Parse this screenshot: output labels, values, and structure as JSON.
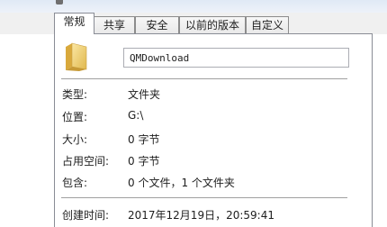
{
  "tabs": [
    {
      "label": "常规"
    },
    {
      "label": "共享"
    },
    {
      "label": "安全"
    },
    {
      "label": "以前的版本"
    },
    {
      "label": "自定义"
    }
  ],
  "general": {
    "icon": "folder-icon",
    "name_value": "QMDownload",
    "properties": [
      {
        "label": "类型:",
        "value": "文件夹"
      },
      {
        "label": "位置:",
        "value": "G:\\"
      },
      {
        "label": "大小:",
        "value": "0 字节"
      },
      {
        "label": "占用空间:",
        "value": "0 字节"
      },
      {
        "label": "包含:",
        "value": "0 个文件，1 个文件夹"
      }
    ],
    "created": {
      "label": "创建时间:",
      "value": "2017年12月19日，20:59:41"
    }
  }
}
